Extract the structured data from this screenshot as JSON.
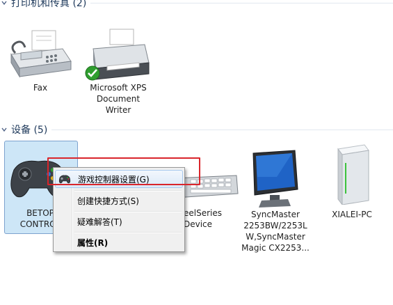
{
  "sections": {
    "printers_header": "打印机和传真 (2)",
    "devices_header": "设备 (5)"
  },
  "printers": [
    {
      "label": "Fax",
      "icon": "fax-icon"
    },
    {
      "label": "Microsoft XPS\nDocument\nWriter",
      "icon": "printer-icon",
      "default_badge": "default-checkmark-icon"
    }
  ],
  "devices": [
    {
      "label": "BETOP\nCONTROLLER",
      "label_visible": "BETOP\nCONTROL",
      "icon": "gamepad-icon"
    },
    {
      "label": "SteelSeries\nDevice",
      "label_visible": "eelSeries\nDevice",
      "icon": "keyboard-icon"
    },
    {
      "label": "SyncMaster\n2253BW/2253L\nW,SyncMaster\nMagic CX2253...",
      "icon": "monitor-icon"
    },
    {
      "label": "XIALEI-PC",
      "icon": "computer-tower-icon"
    }
  ],
  "context_menu": {
    "items": [
      {
        "label": "游戏控制器设置(G)",
        "icon": "gamepad-small-icon",
        "highlighted": true
      },
      {
        "label": "创建快捷方式(S)"
      },
      {
        "label": "疑难解答(T)"
      },
      {
        "label": "属性(R)",
        "bold": true
      }
    ]
  },
  "colors": {
    "highlight_box": "#d9252b",
    "selection": "#cde6f7"
  }
}
